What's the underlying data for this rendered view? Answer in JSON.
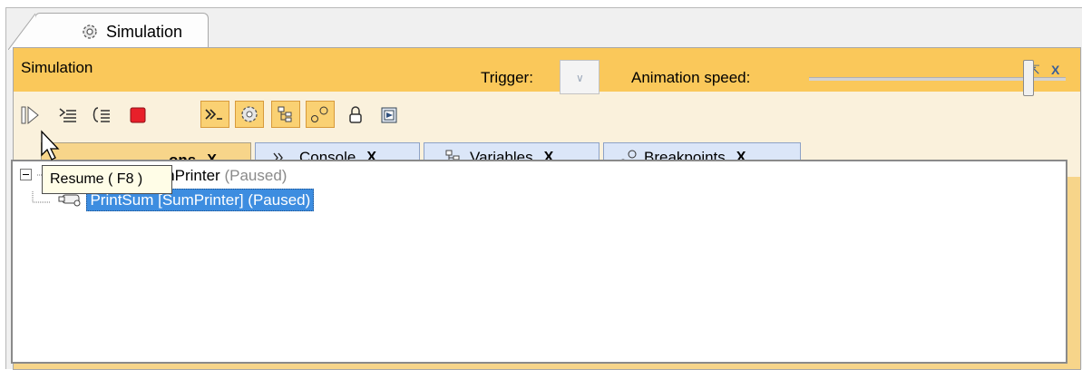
{
  "doc_tab": {
    "label": "Simulation",
    "icon": "simulation-gear-icon"
  },
  "panel": {
    "title": "Simulation",
    "title_icons": [
      "restore-icon",
      "close-icon"
    ],
    "close_glyph": "X"
  },
  "toolbar": {
    "buttons": [
      {
        "name": "resume-button",
        "icon": "resume-icon"
      },
      {
        "name": "step-into-button",
        "icon": "step-into-icon"
      },
      {
        "name": "step-over-button",
        "icon": "step-over-icon"
      },
      {
        "name": "stop-button",
        "icon": "stop-icon"
      },
      {
        "name": "console-toggle-button",
        "icon": "console-icon",
        "active": true
      },
      {
        "name": "sessions-toggle-button",
        "icon": "gear-icon",
        "active": true
      },
      {
        "name": "variables-toggle-button",
        "icon": "variables-icon",
        "active": true
      },
      {
        "name": "breakpoints-toggle-button",
        "icon": "breakpoints-icon",
        "active": true
      },
      {
        "name": "lock-button",
        "icon": "lock-icon"
      },
      {
        "name": "export-button",
        "icon": "export-icon"
      }
    ],
    "trigger_label": "Trigger:",
    "speed_label": "Animation speed:",
    "animation_speed": 0.85
  },
  "tabs": [
    {
      "label": "ons",
      "close": "X"
    },
    {
      "label": "Console",
      "close": "X"
    },
    {
      "label": "Variables",
      "close": "X"
    },
    {
      "label": "Breakpoints",
      "close": "X"
    }
  ],
  "tree": {
    "root": {
      "label": "instance : SumPrinter",
      "status": "(Paused)"
    },
    "child": {
      "label": "PrintSum [SumPrinter] (Paused)"
    }
  },
  "tooltip": {
    "text": "Resume ( F8 )"
  },
  "colors": {
    "panel_title": "#fac85a",
    "toggle_active": "#fad173",
    "tab_inactive": "#dbe6f8",
    "selection": "#3d8de0"
  }
}
